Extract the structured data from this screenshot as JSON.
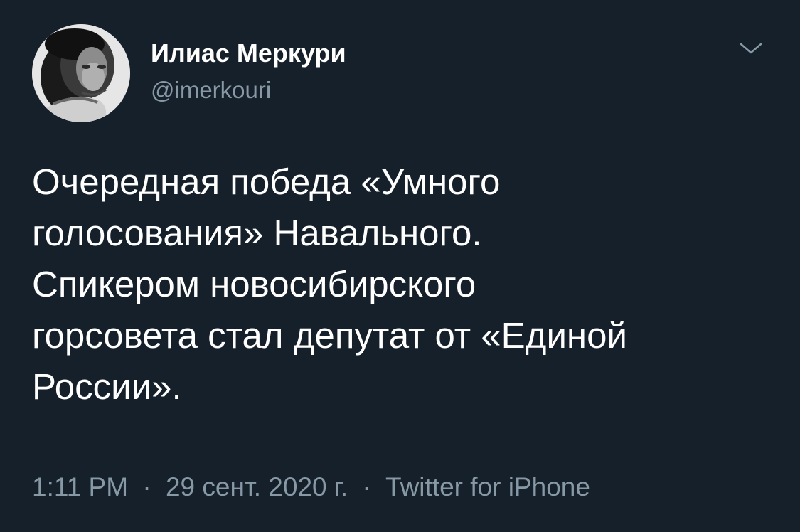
{
  "author": {
    "display_name": "Илиас Меркури",
    "handle": "@imerkouri"
  },
  "tweet": {
    "text_lines": [
      "Очередная победа «Умного",
      "голосования» Навального.",
      "Спикером новосибирского",
      "горсовета стал депутат от «Единой",
      "России»."
    ],
    "time": "1:11 PM",
    "separator": "·",
    "date": "29 сент. 2020 г.",
    "source": "Twitter for iPhone"
  },
  "icons": {
    "caret": "chevron-down-icon",
    "avatar": "profile-photo"
  },
  "colors": {
    "background": "#15202b",
    "primary_text": "#ffffff",
    "secondary_text": "#8899a6",
    "divider": "#38444d"
  }
}
